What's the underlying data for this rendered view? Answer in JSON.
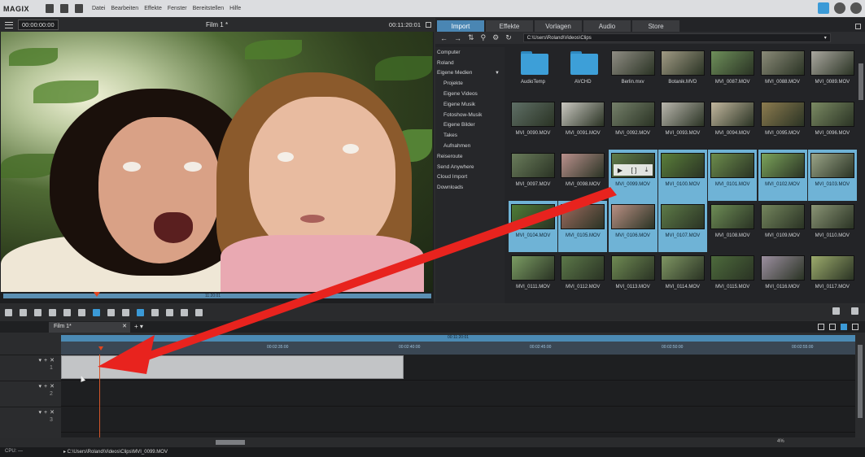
{
  "app": {
    "logo": "MAGIX",
    "menu": [
      "Datei",
      "Bearbeiten",
      "Effekte",
      "Fenster",
      "Bereitstellen",
      "Hilfe"
    ]
  },
  "preview": {
    "timecode_left": "00:00:00:00",
    "title": "Film 1 *",
    "timecode_right": "00:11:20:01",
    "scrub_label": "11:20:01",
    "transport": [
      "[",
      "]",
      "|⇤",
      "|◀",
      "▶",
      "[▶]",
      "⇥"
    ]
  },
  "media_pool": {
    "tabs": [
      "Import",
      "Effekte",
      "Vorlagen",
      "Audio",
      "Store"
    ],
    "active_tab": "Import",
    "path": "C:\\Users\\Roland\\Videos\\Clips",
    "tree": [
      {
        "label": "Computer",
        "sub": false
      },
      {
        "label": "Roland",
        "sub": false
      },
      {
        "label": "Eigene Medien",
        "sub": false,
        "caret": "▼"
      },
      {
        "label": "Projekte",
        "sub": true
      },
      {
        "label": "Eigene Videos",
        "sub": true
      },
      {
        "label": "Eigene Musik",
        "sub": true
      },
      {
        "label": "Fotoshow-Musik",
        "sub": true
      },
      {
        "label": "Eigene Bilder",
        "sub": true
      },
      {
        "label": "Takes",
        "sub": true
      },
      {
        "label": "Aufnahmen",
        "sub": true
      },
      {
        "label": "Reiseroute",
        "sub": false
      },
      {
        "label": "Send Anywhere",
        "sub": false
      },
      {
        "label": "Cloud Import",
        "sub": false
      },
      {
        "label": "Downloads",
        "sub": false
      }
    ],
    "files": [
      {
        "name": "AudioTemp",
        "folder": true,
        "selected": false
      },
      {
        "name": "AVCHD",
        "folder": true,
        "selected": false
      },
      {
        "name": "Berlin.mxv",
        "selected": false,
        "color": "#8f8c83"
      },
      {
        "name": "Botanik.MVD",
        "selected": false,
        "color": "#a09a84"
      },
      {
        "name": "MVI_0087.MOV",
        "selected": false,
        "color": "#6e8f5a"
      },
      {
        "name": "MVI_0088.MOV",
        "selected": false,
        "color": "#8a8a78"
      },
      {
        "name": "MVI_0089.MOV",
        "selected": false,
        "color": "#aaa79f"
      },
      {
        "name": "MVI_0090.MOV",
        "selected": false,
        "color": "#5f6f66"
      },
      {
        "name": "MVI_0091.MOV",
        "selected": false,
        "color": "#c9c7c0"
      },
      {
        "name": "MVI_0092.MOV",
        "selected": false,
        "color": "#75806a"
      },
      {
        "name": "MVI_0093.MOV",
        "selected": false,
        "color": "#b9b6ad"
      },
      {
        "name": "MVI_0094.MOV",
        "selected": false,
        "color": "#c2b79e"
      },
      {
        "name": "MVI_0095.MOV",
        "selected": false,
        "color": "#8c7b4f"
      },
      {
        "name": "MVI_0096.MOV",
        "selected": false,
        "color": "#7b8a63"
      },
      {
        "name": "MVI_0097.MOV",
        "selected": false,
        "color": "#6a7c5b"
      },
      {
        "name": "MVI_0098.MOV",
        "selected": false,
        "color": "#b9908c"
      },
      {
        "name": "MVI_0099.MOV",
        "selected": true,
        "hover": true,
        "color": "#5f7a48"
      },
      {
        "name": "MVI_0100.MOV",
        "selected": true,
        "color": "#5a7e3a"
      },
      {
        "name": "MVI_0101.MOV",
        "selected": true,
        "color": "#6c8c4c"
      },
      {
        "name": "MVI_0102.MOV",
        "selected": true,
        "color": "#7ba35a"
      },
      {
        "name": "MVI_0103.MOV",
        "selected": true,
        "color": "#9aa487"
      },
      {
        "name": "MVI_0104.MOV",
        "selected": true,
        "color": "#4f7c36"
      },
      {
        "name": "MVI_0105.MOV",
        "selected": true,
        "color": "#9b6a5e"
      },
      {
        "name": "MVI_0106.MOV",
        "selected": true,
        "color": "#b98f83"
      },
      {
        "name": "MVI_0107.MOV",
        "selected": true,
        "color": "#5d7a47"
      },
      {
        "name": "MVI_0108.MOV",
        "selected": false,
        "color": "#6d8c55"
      },
      {
        "name": "MVI_0109.MOV",
        "selected": false,
        "color": "#74855d"
      },
      {
        "name": "MVI_0110.MOV",
        "selected": false,
        "color": "#8a9475"
      },
      {
        "name": "MVI_0111.MOV",
        "selected": false,
        "color": "#7b9c63"
      },
      {
        "name": "MVI_0112.MOV",
        "selected": false,
        "color": "#5c7849"
      },
      {
        "name": "MVI_0113.MOV",
        "selected": false,
        "color": "#6f8a53"
      },
      {
        "name": "MVI_0114.MOV",
        "selected": false,
        "color": "#7f9663"
      },
      {
        "name": "MVI_0115.MOV",
        "selected": false,
        "color": "#4d6a3c"
      },
      {
        "name": "MVI_0116.MOV",
        "selected": false,
        "color": "#9c8fa0"
      },
      {
        "name": "MVI_0117.MOV",
        "selected": false,
        "color": "#9cab6c"
      }
    ]
  },
  "timeline": {
    "tab_label": "Film 1*",
    "ruler_top_label": "00:11:20:01",
    "ruler_ticks": [
      "00:02:35:00",
      "00:02:40:00",
      "00:02:45:00",
      "00:02:50:00",
      "00:02:55:00"
    ],
    "tracks": [
      "1",
      "2",
      "3"
    ],
    "zoom": "4%"
  },
  "status": {
    "cpu": "CPU: —",
    "path": "▸ C:\\Users\\Roland\\Videos\\Clips\\MVI_0099.MOV"
  },
  "colors": {
    "accent": "#3b9ad7",
    "selection": "#6fb3d6",
    "playhead": "#e2451e",
    "arrow": "#e8231e"
  }
}
